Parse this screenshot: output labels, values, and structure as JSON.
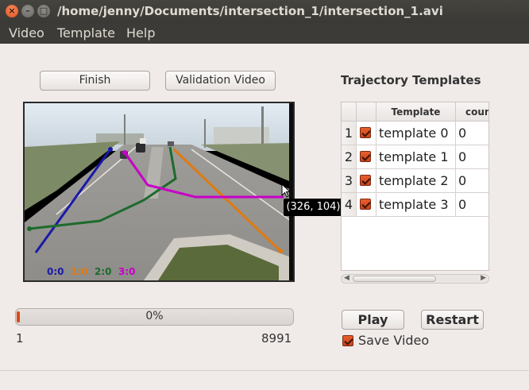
{
  "window": {
    "title": "/home/jenny/Documents/intersection_1/intersection_1.avi",
    "close_glyph": "×",
    "minimize_glyph": "–",
    "maximize_glyph": "□"
  },
  "menu": {
    "video": "Video",
    "template": "Template",
    "help": "Help"
  },
  "controls": {
    "finish": "Finish",
    "validation_video": "Validation Video",
    "play": "Play",
    "restart": "Restart"
  },
  "video": {
    "legend": [
      {
        "text": "0:0",
        "color": "#1a1aa8"
      },
      {
        "text": "1:0",
        "color": "#e07a10"
      },
      {
        "text": "2:0",
        "color": "#1d6b2c"
      },
      {
        "text": "3:0",
        "color": "#c800c8"
      }
    ],
    "tooltip": "(326, 104)"
  },
  "progress": {
    "percent_text": "0%",
    "value": 0.005,
    "min": "1",
    "max": "8991"
  },
  "templates": {
    "heading": "Trajectory Templates",
    "columns": [
      "Template",
      "coun"
    ],
    "rows": [
      {
        "num": "1",
        "name": "template 0",
        "count": "0",
        "checked": true
      },
      {
        "num": "2",
        "name": "template 1",
        "count": "0",
        "checked": true
      },
      {
        "num": "3",
        "name": "template 2",
        "count": "0",
        "checked": true
      },
      {
        "num": "4",
        "name": "template 3",
        "count": "0",
        "checked": true
      }
    ]
  },
  "save_video": {
    "label": "Save Video",
    "checked": true
  },
  "colors": {
    "accent": "#dd4814",
    "titlebar": "#3c3b37"
  }
}
